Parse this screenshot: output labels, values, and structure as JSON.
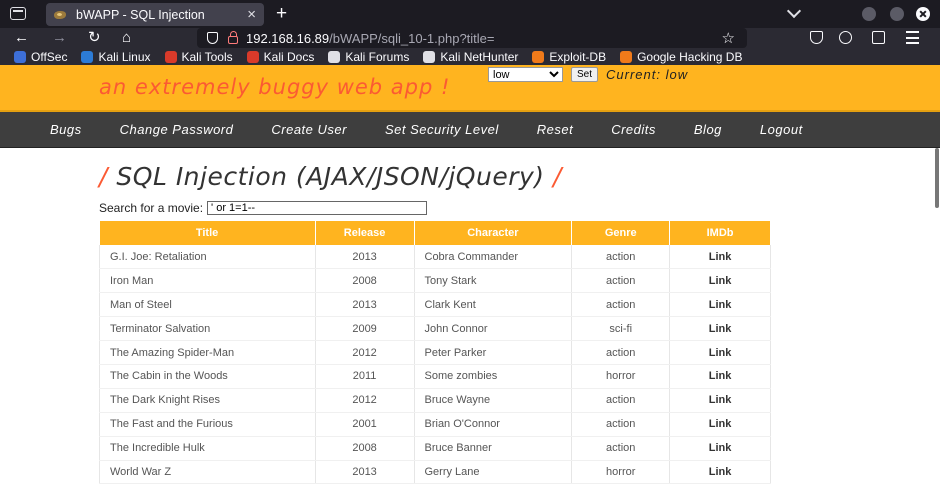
{
  "browser": {
    "tab_title": "bWAPP - SQL Injection",
    "new_tab": "+",
    "url_host": "192.168.16.89",
    "url_path": "/bWAPP/sqli_10-1.php?title=",
    "bookmarks": [
      {
        "label": "OffSec",
        "color": "#3d6fd8"
      },
      {
        "label": "Kali Linux",
        "color": "#2c7bd6"
      },
      {
        "label": "Kali Tools",
        "color": "#d83a2a"
      },
      {
        "label": "Kali Docs",
        "color": "#d83a2a"
      },
      {
        "label": "Kali Forums",
        "color": "#e0e0e6"
      },
      {
        "label": "Kali NetHunter",
        "color": "#e0e0e6"
      },
      {
        "label": "Exploit-DB",
        "color": "#f07a1a"
      },
      {
        "label": "Google Hacking DB",
        "color": "#f07a1a"
      }
    ]
  },
  "header": {
    "tagline": "an extremely buggy web app !",
    "security_level": "low",
    "set_button": "Set",
    "current_label": "Current: low"
  },
  "menu": [
    "Bugs",
    "Change Password",
    "Create User",
    "Set Security Level",
    "Reset",
    "Credits",
    "Blog",
    "Logout"
  ],
  "page": {
    "title": "SQL Injection (AJAX/JSON/jQuery)",
    "slash": "/",
    "search_label": "Search for a movie:",
    "search_value": "' or 1=1--"
  },
  "table": {
    "headers": [
      "Title",
      "Release",
      "Character",
      "Genre",
      "IMDb"
    ],
    "rows": [
      [
        "G.I. Joe: Retaliation",
        "2013",
        "Cobra Commander",
        "action",
        "Link"
      ],
      [
        "Iron Man",
        "2008",
        "Tony Stark",
        "action",
        "Link"
      ],
      [
        "Man of Steel",
        "2013",
        "Clark Kent",
        "action",
        "Link"
      ],
      [
        "Terminator Salvation",
        "2009",
        "John Connor",
        "sci-fi",
        "Link"
      ],
      [
        "The Amazing Spider-Man",
        "2012",
        "Peter Parker",
        "action",
        "Link"
      ],
      [
        "The Cabin in the Woods",
        "2011",
        "Some zombies",
        "horror",
        "Link"
      ],
      [
        "The Dark Knight Rises",
        "2012",
        "Bruce Wayne",
        "action",
        "Link"
      ],
      [
        "The Fast and the Furious",
        "2001",
        "Brian O'Connor",
        "action",
        "Link"
      ],
      [
        "The Incredible Hulk",
        "2008",
        "Bruce Banner",
        "action",
        "Link"
      ],
      [
        "World War Z",
        "2013",
        "Gerry Lane",
        "horror",
        "Link"
      ]
    ]
  }
}
